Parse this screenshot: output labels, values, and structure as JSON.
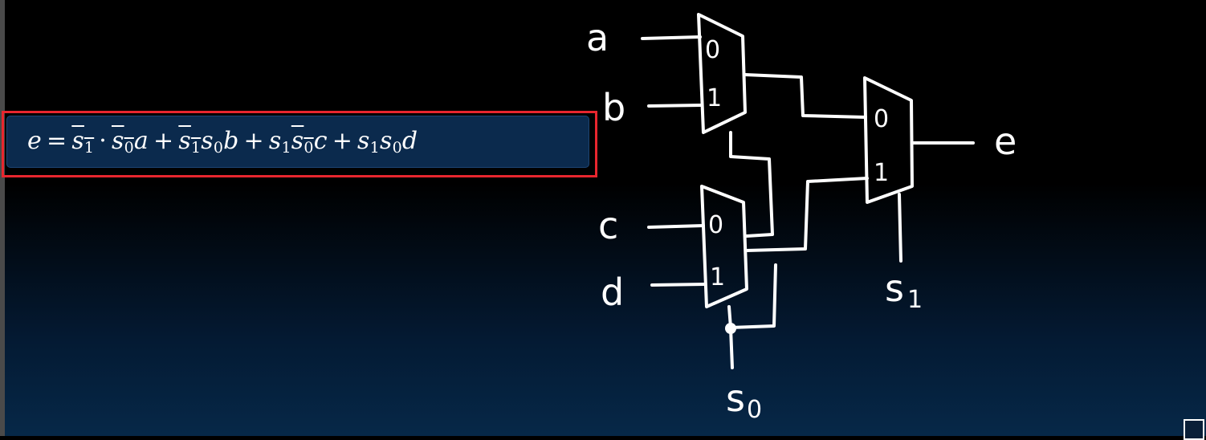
{
  "formula": {
    "e": "e",
    "eq": "=",
    "s": "s",
    "sub1": "1",
    "sub0": "0",
    "dot": "·",
    "plus": "+",
    "a": "a",
    "b": "b",
    "c": "c",
    "d": "d"
  },
  "diagram": {
    "input_a": "a",
    "input_b": "b",
    "input_c": "c",
    "input_d": "d",
    "output_e": "e",
    "select_s0": "s",
    "select_s1": "s",
    "s0_sub": "0",
    "s1_sub": "1",
    "mux_in0": "0",
    "mux_in1": "1"
  },
  "colors": {
    "highlight": "#e8262e",
    "formula_bg": "#0b2a4d",
    "ink": "#ffffff"
  }
}
